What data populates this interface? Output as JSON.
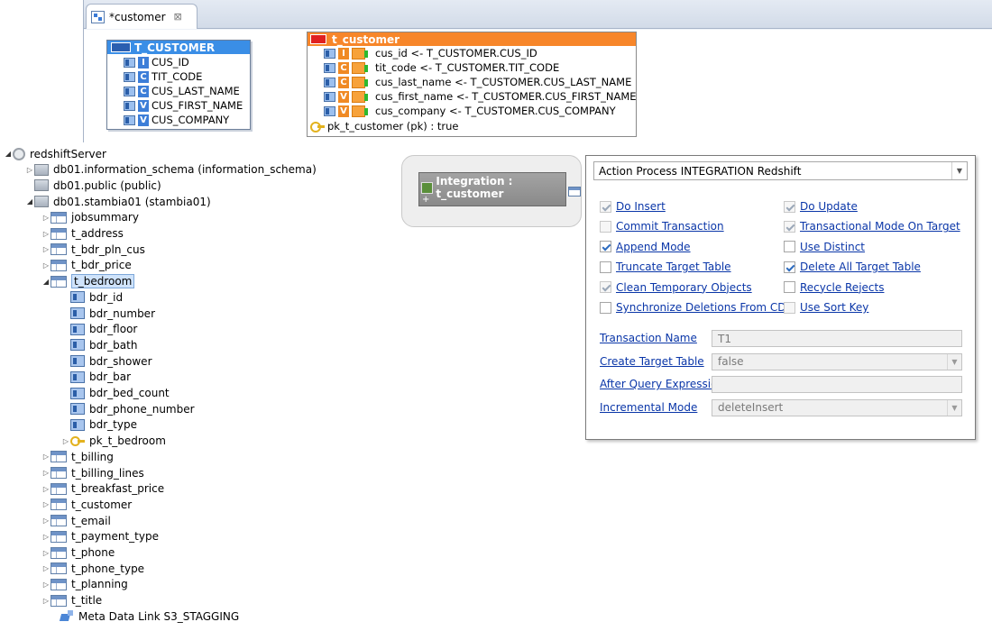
{
  "editor": {
    "tab_title": "*customer",
    "tab_close": "⊠"
  },
  "source": {
    "title": "T_CUSTOMER",
    "columns": [
      {
        "badge": "I",
        "badge_sup": "*",
        "name": "CUS_ID"
      },
      {
        "badge": "C",
        "badge_sup": "",
        "name": "TIT_CODE"
      },
      {
        "badge": "C",
        "badge_sup": "*",
        "name": "CUS_LAST_NAME"
      },
      {
        "badge": "V",
        "badge_sup": "",
        "name": "CUS_FIRST_NAME"
      },
      {
        "badge": "V",
        "badge_sup": "",
        "name": "CUS_COMPANY"
      }
    ]
  },
  "target": {
    "title": "t_customer",
    "mappings": [
      {
        "badge": "I",
        "text": "cus_id <- T_CUSTOMER.CUS_ID"
      },
      {
        "badge": "C",
        "text": "tit_code <- T_CUSTOMER.TIT_CODE"
      },
      {
        "badge": "C",
        "text": "cus_last_name <- T_CUSTOMER.CUS_LAST_NAME"
      },
      {
        "badge": "V",
        "text": "cus_first_name <- T_CUSTOMER.CUS_FIRST_NAME"
      },
      {
        "badge": "V",
        "text": "cus_company <- T_CUSTOMER.CUS_COMPANY"
      }
    ],
    "pk": "pk_t_customer (pk) : true"
  },
  "tree": {
    "server": "redshiftServer",
    "schemas": {
      "info": "db01.information_schema (information_schema)",
      "public": "db01.public (public)",
      "stambia": "db01.stambia01 (stambia01)"
    },
    "tables_before": [
      "jobsummary",
      "t_address",
      "t_bdr_pln_cus",
      "t_bdr_price"
    ],
    "expanded_table": "t_bedroom",
    "bedroom_columns": [
      "bdr_id",
      "bdr_number",
      "bdr_floor",
      "bdr_bath",
      "bdr_shower",
      "bdr_bar",
      "bdr_bed_count",
      "bdr_phone_number",
      "bdr_type"
    ],
    "bedroom_key": "pk_t_bedroom",
    "tables_after": [
      "t_billing",
      "t_billing_lines",
      "t_breakfast_price",
      "t_customer",
      "t_email",
      "t_payment_type",
      "t_phone",
      "t_phone_type",
      "t_planning",
      "t_title"
    ],
    "metadata_link": "Meta Data Link S3_STAGGING"
  },
  "integration": {
    "label": "Integration : t_customer",
    "plus": "+"
  },
  "props": {
    "process": "Action Process INTEGRATION Redshift",
    "left_options": [
      {
        "label": "Do Insert",
        "checked": true,
        "dim": true
      },
      {
        "label": "Commit Transaction",
        "checked": false,
        "dim": true
      },
      {
        "label": "Append Mode",
        "checked": true,
        "dim": false
      },
      {
        "label": "Truncate Target Table",
        "checked": false,
        "dim": false
      },
      {
        "label": "Clean Temporary Objects",
        "checked": true,
        "dim": true
      },
      {
        "label": "Synchronize Deletions From CDC",
        "checked": false,
        "dim": false
      }
    ],
    "right_options": [
      {
        "label": "Do Update",
        "checked": true,
        "dim": true
      },
      {
        "label": "Transactional Mode On Target",
        "checked": true,
        "dim": true
      },
      {
        "label": "Use Distinct",
        "checked": false,
        "dim": false
      },
      {
        "label": "Delete All Target Table",
        "checked": true,
        "dim": false
      },
      {
        "label": "Recycle Rejects",
        "checked": false,
        "dim": false
      },
      {
        "label": "Use Sort Key",
        "checked": false,
        "dim": true
      }
    ],
    "fields": [
      {
        "label": "Transaction Name",
        "value": "T1",
        "dropdown": false
      },
      {
        "label": "Create Target Table",
        "value": "false",
        "dropdown": true
      },
      {
        "label": "After Query Expression",
        "value": "",
        "dropdown": false
      },
      {
        "label": "Incremental Mode",
        "value": "deleteInsert",
        "dropdown": true
      }
    ]
  }
}
